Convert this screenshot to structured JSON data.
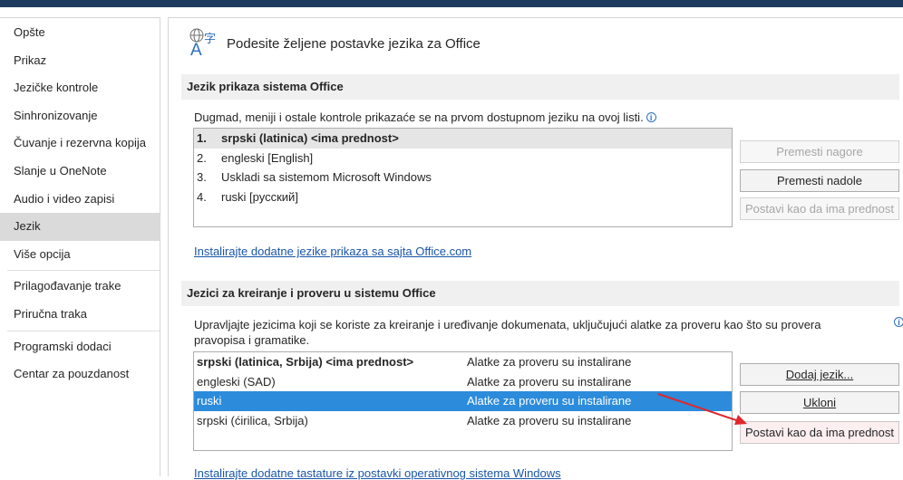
{
  "sidebar": {
    "items": [
      {
        "label": "Opšte"
      },
      {
        "label": "Prikaz"
      },
      {
        "label": "Jezičke kontrole"
      },
      {
        "label": "Sinhronizovanje"
      },
      {
        "label": "Čuvanje i rezervna kopija"
      },
      {
        "label": "Slanje u OneNote"
      },
      {
        "label": "Audio i video zapisi"
      },
      {
        "label": "Jezik"
      },
      {
        "label": "Više opcija"
      },
      {
        "label": "Prilagođavanje trake"
      },
      {
        "label": "Priručna traka"
      },
      {
        "label": "Programski dodaci"
      },
      {
        "label": "Centar za pouzdanost"
      }
    ]
  },
  "header": {
    "title": "Podesite željene postavke jezika za Office",
    "icon": "language-icon"
  },
  "display_section": {
    "title": "Jezik prikaza sistema Office",
    "description": "Dugmad, meniji i ostale kontrole prikazaće se na prvom dostupnom jeziku na ovoj listi.",
    "languages": [
      {
        "num": "1.",
        "label": "srpski (latinica) <ima prednost>"
      },
      {
        "num": "2.",
        "label": "engleski [English]"
      },
      {
        "num": "3.",
        "label": "Uskladi sa sistemom Microsoft Windows"
      },
      {
        "num": "4.",
        "label": "ruski [русский]"
      }
    ],
    "btn_move_up": "Premesti nagore",
    "btn_move_down": "Premesti nadole",
    "btn_set_preferred": "Postavi kao da ima prednost",
    "link": "Instalirajte dodatne jezike prikaza sa sajta Office.com"
  },
  "authoring_section": {
    "title": "Jezici za kreiranje i proveru u sistemu Office",
    "description_line1": "Upravljajte jezicima koji se koriste za kreiranje i uređivanje dokumenata, uključujući alatke za proveru kao što su provera",
    "description_line2": "pravopisa i gramatike.",
    "languages": [
      {
        "label": "srpski (latinica, Srbija) <ima prednost>",
        "status": "Alatke za proveru su instalirane"
      },
      {
        "label": "engleski (SAD)",
        "status": "Alatke za proveru su instalirane"
      },
      {
        "label": "ruski",
        "status": "Alatke za proveru su instalirane"
      },
      {
        "label": "srpski (ćirilica, Srbija)",
        "status": "Alatke za proveru su instalirane"
      }
    ],
    "btn_add": "Dodaj jezik...",
    "btn_remove": "Ukloni",
    "btn_set_preferred": "Postavi kao da ima prednost",
    "link": "Instalirajte dodatne tastature iz postavki operativnog sistema Windows"
  },
  "colors": {
    "selection": "#2c8bdb",
    "arrow": "#e0262c",
    "link": "#1a56a8"
  }
}
